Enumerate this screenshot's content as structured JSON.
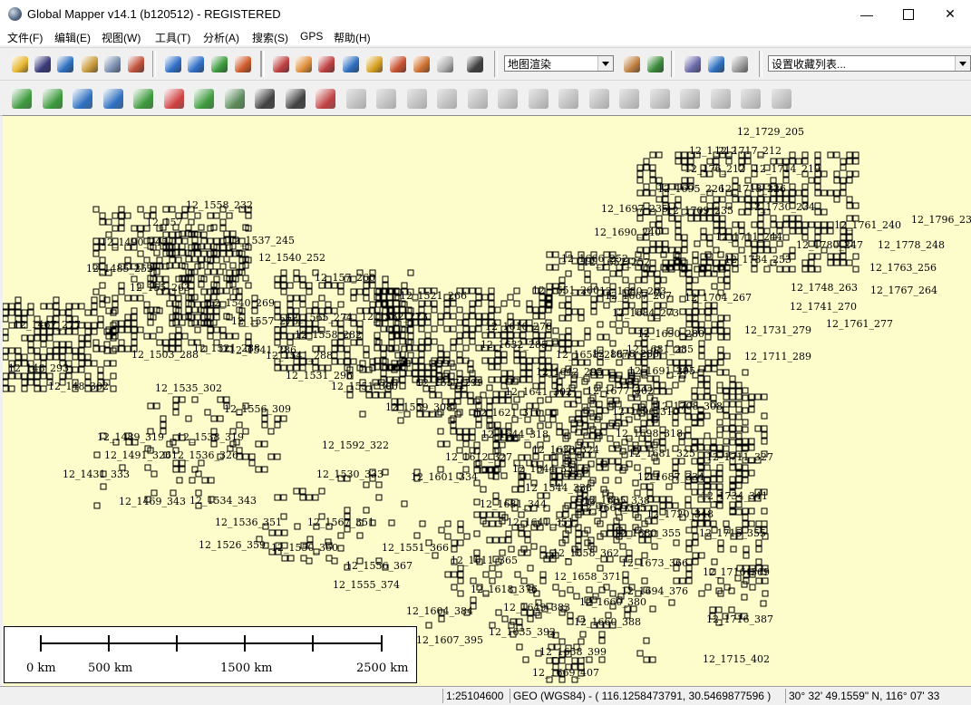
{
  "window": {
    "title": "Global Mapper v14.1 (b120512) - REGISTERED",
    "minimize": "—",
    "close": "✕"
  },
  "menu": [
    {
      "label": "文件(F)"
    },
    {
      "label": "编辑(E)"
    },
    {
      "label": "视图(W)"
    },
    {
      "label": "工具(T)"
    },
    {
      "label": "分析(A)"
    },
    {
      "label": "搜索(S)"
    },
    {
      "label": "GPS"
    },
    {
      "label": "帮助(H)"
    }
  ],
  "toolbar": {
    "render_mode": "地图渲染",
    "bookmarks": "设置收藏列表...",
    "buttons1": [
      {
        "icon": "open-folder-icon",
        "color": "#e8b730"
      },
      {
        "icon": "save-disk-icon",
        "color": "#3a3a7a"
      },
      {
        "icon": "globe-icon",
        "color": "#2d6fc0"
      },
      {
        "icon": "overlay-control-icon",
        "color": "#c99a3a"
      },
      {
        "icon": "config-icon",
        "color": "#7a8fb0"
      },
      {
        "icon": "tools-icon",
        "color": "#c0503a"
      },
      {
        "icon": "zoom-in-icon",
        "color": "#2f6ec8"
      },
      {
        "icon": "zoom-out-icon",
        "color": "#2f6ec8"
      },
      {
        "icon": "zoom-to-layer-icon",
        "color": "#3c9a3c"
      },
      {
        "icon": "home-icon",
        "color": "#d05a2a"
      },
      {
        "icon": "zoom-tool-icon",
        "color": "#c04040"
      },
      {
        "icon": "pan-hand-icon",
        "color": "#e0903a"
      },
      {
        "icon": "measure-icon",
        "color": "#c04040"
      },
      {
        "icon": "feature-info-icon",
        "color": "#2d6fc0"
      },
      {
        "icon": "path-profile-icon",
        "color": "#d8a020"
      },
      {
        "icon": "view-shed-icon",
        "color": "#c85030"
      },
      {
        "icon": "digitizer-icon",
        "color": "#d07030"
      },
      {
        "icon": "disabled-icon",
        "color": "#b0b0b0"
      },
      {
        "icon": "binoculars-icon",
        "color": "#404040"
      },
      {
        "icon": "shader-icon",
        "color": "#c08040"
      },
      {
        "icon": "3d-view-icon",
        "color": "#3a8a3a"
      },
      {
        "icon": "flag-icon",
        "color": "#6a6aaa"
      },
      {
        "icon": "layers-icon",
        "color": "#2d6fc0"
      },
      {
        "icon": "gps-icon",
        "color": "#9a9a9a"
      }
    ],
    "buttons2": [
      {
        "icon": "create-area-icon",
        "color": "#3c9a3c"
      },
      {
        "icon": "create-line-icon",
        "color": "#3c9a3c"
      },
      {
        "icon": "create-contour-icon",
        "color": "#2d6fc0"
      },
      {
        "icon": "create-watershed-icon",
        "color": "#2d6fc0"
      },
      {
        "icon": "create-feature-icon",
        "color": "#3c9a3c"
      },
      {
        "icon": "edit-code-icon",
        "color": "#d04040"
      },
      {
        "icon": "rotate-icon",
        "color": "#3c9a3c"
      },
      {
        "icon": "grid-icon",
        "color": "#5a8a5a"
      },
      {
        "icon": "move-vertex-icon",
        "color": "#404040"
      },
      {
        "icon": "add-vertex-icon",
        "color": "#404040"
      },
      {
        "icon": "cut-icon",
        "color": "#c04040"
      },
      {
        "icon": "disabled-icon",
        "color": "#b8b8b8"
      },
      {
        "icon": "disabled-icon",
        "color": "#b8b8b8"
      },
      {
        "icon": "disabled-icon",
        "color": "#b8b8b8"
      },
      {
        "icon": "disabled-icon",
        "color": "#b8b8b8"
      },
      {
        "icon": "disabled-icon",
        "color": "#b8b8b8"
      },
      {
        "icon": "disabled-icon",
        "color": "#b8b8b8"
      },
      {
        "icon": "disabled-icon",
        "color": "#b8b8b8"
      },
      {
        "icon": "disabled-icon",
        "color": "#b8b8b8"
      },
      {
        "icon": "disabled-icon",
        "color": "#b8b8b8"
      },
      {
        "icon": "disabled-icon",
        "color": "#b8b8b8"
      },
      {
        "icon": "disabled-icon",
        "color": "#b8b8b8"
      },
      {
        "icon": "disabled-icon",
        "color": "#b8b8b8"
      },
      {
        "icon": "disabled-icon",
        "color": "#b8b8b8"
      },
      {
        "icon": "disabled-icon",
        "color": "#b8b8b8"
      },
      {
        "icon": "disabled-icon",
        "color": "#b8b8b8"
      }
    ]
  },
  "map": {
    "background": "#fdfccb",
    "tile_labels": [
      "12_1729_205",
      "12_1_212",
      "12_1717_212",
      "12_176_212",
      "12_1714_219",
      "12_1695_226",
      "12_1713_226",
      "12_1730_234",
      "12_1697_235",
      "12_1709_235",
      "12_1761_240",
      "12_1796_23",
      "12_1690_240",
      "12_1711_244",
      "12_1780_247",
      "12_1778_248",
      "12_1734_253",
      "12_1763_256",
      "12_1748_263",
      "12_1767_264",
      "12_1741_270",
      "12_1761_277",
      "12_1731_279",
      "12_1711_289",
      "12_1558_232",
      "12_157",
      "12_1490_245",
      "12_1537_245",
      "12_1540_252",
      "12_1485_252",
      "12_155_263",
      "12_157_260",
      "12_1521_266",
      "12_1540_269",
      "12_1557_276",
      "12_1532_273",
      "12_1565_274",
      "12_1467_277",
      "12_1558_282",
      "12_1541_286",
      "12_1503_288",
      "12_1521_288",
      "12_1541_288",
      "12_148_293",
      "12_1531_296",
      "12_148_302",
      "12_1535_302",
      "12_1551_300",
      "12_1556_309",
      "12_1559_308",
      "12_1621_310",
      "12_1666_252",
      "12_1652_252",
      "12_1651_260",
      "12_1680_263",
      "12_1667_267",
      "12_1704_267",
      "12_1684_273",
      "12_1690_280",
      "12_1610_278",
      "12_1681_285",
      "12_1632_285",
      "12_1676_288",
      "12_1658_288",
      "12_1691_295",
      "12_1642_295",
      "12_1657_299",
      "12_1677_302",
      "12_1641_302",
      "12_1708_308",
      "12_1696_310",
      "12_1698_318",
      "12_1644_318",
      "12_1489_319",
      "12_1538_319",
      "12_1491_326",
      "12_1536_326",
      "12_1592_322",
      "12_1633_324",
      "12_1681_325",
      "12_1612_327",
      "12_1711_327",
      "12_1431_333",
      "12_1530_333",
      "12_1601_334",
      "12_1644_331",
      "12_1687_334",
      "12_1544_338",
      "12_1635_338",
      "12_1734_341",
      "12_1469_343",
      "12_1534_343",
      "12_1631_344",
      "12_1667_345",
      "12_1720_348",
      "12_1536_351",
      "12_1567_351",
      "12_1641_351",
      "12_1680_355",
      "12_1715_355",
      "12_1526_359",
      "12_1550_360",
      "12_1551_366",
      "12_1658_362",
      "12_1611_365",
      "12_1673_366",
      "12_1556_367",
      "12_1716_369",
      "12_1658_371",
      "12_1555_374",
      "12_1618_376",
      "12_1694_376",
      "12_1649_383",
      "12_1660_380",
      "12_1604_384",
      "12_1716_387",
      "12_1660_388",
      "12_1635_392",
      "12_1607_395",
      "12_1658_399",
      "12_1715_402",
      "12_1669_407"
    ]
  },
  "scale_bar": {
    "labels": [
      "0 km",
      "500 km",
      "1500 km",
      "2500 km"
    ]
  },
  "status": {
    "scale": "1:25104600",
    "projection": "GEO (WGS84)",
    "coords_decimal": "- ( 116.1258473791, 30.5469877596 )",
    "coords_dms": "30° 32' 49.1559\" N, 116° 07' 33"
  }
}
